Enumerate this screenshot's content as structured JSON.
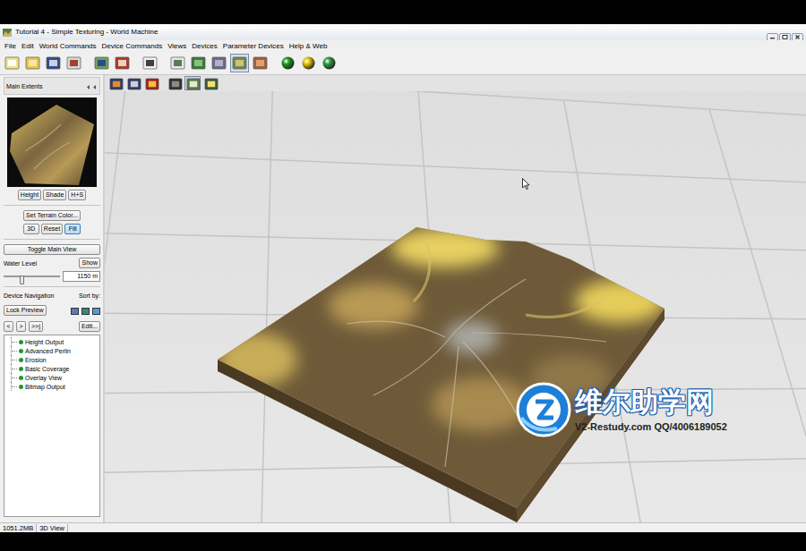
{
  "window": {
    "title": "Tutorial 4 - Simple Texturing - World Machine"
  },
  "menu": [
    "File",
    "Edit",
    "World Commands",
    "Device Commands",
    "Views",
    "Devices",
    "Parameter Devices",
    "Help & Web"
  ],
  "main_toolbar": [
    {
      "selected": false
    },
    {
      "selected": false
    },
    {
      "selected": false
    },
    {
      "selected": false
    },
    {
      "selected": false
    },
    {
      "selected": false
    },
    {
      "selected": false
    },
    {
      "selected": false
    },
    {
      "selected": false
    },
    {
      "selected": false
    },
    {
      "selected": true
    },
    {
      "selected": false
    },
    {
      "selected": false
    },
    {
      "selected": false
    },
    {
      "selected": false
    }
  ],
  "view_toolbar": [
    {
      "selected": false
    },
    {
      "selected": false
    },
    {
      "selected": false
    },
    {
      "selected": false
    },
    {
      "selected": true
    },
    {
      "selected": false
    }
  ],
  "preview": {
    "title": "Main Extents"
  },
  "view_buttons": [
    {
      "label": "Height",
      "selected": false
    },
    {
      "label": "Shade",
      "selected": false
    },
    {
      "label": "H+S",
      "selected": false
    }
  ],
  "terrain_color_button": "Set Terrain Color...",
  "mode_buttons": [
    {
      "label": "3D",
      "selected": false
    },
    {
      "label": "Reset",
      "selected": false
    },
    {
      "label": "Fill",
      "selected": true
    }
  ],
  "toggle_button": "Toggle Main View",
  "water": {
    "label": "Water Level",
    "button": "Show",
    "level": 0.32,
    "value": "1150 m"
  },
  "navigation": {
    "label": "Device Navigation",
    "sort_label": "Sort by:",
    "lock_button": "Lock Preview",
    "nav_buttons": [
      "<",
      ">",
      ">>|"
    ],
    "edit_button": "Edit..."
  },
  "devices": [
    "Height Output",
    "Advanced Perlin",
    "Erosion",
    "Basic Coverage",
    "Overlay View",
    "Bitmap Output"
  ],
  "status_bar": {
    "memory": "1051.2MB",
    "view": "3D View"
  },
  "watermark": {
    "brand": "维尔助学网",
    "site": "V2-Restudy.com  QQ/4006189052"
  }
}
